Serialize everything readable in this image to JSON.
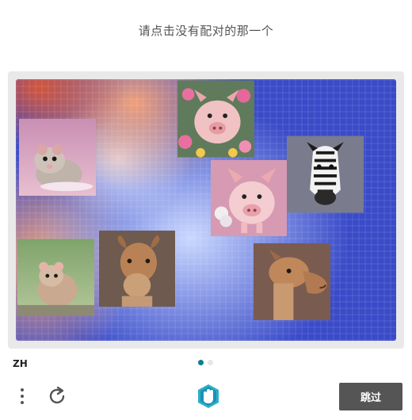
{
  "prompt": "请点击没有配对的那一个",
  "language": "ZH",
  "skip_label": "跳过",
  "pagination": {
    "current": 1,
    "total": 2
  },
  "tiles": [
    {
      "id": "hamster-1",
      "animal": "hamster"
    },
    {
      "id": "pig-1",
      "animal": "pig"
    },
    {
      "id": "zebra",
      "animal": "zebra"
    },
    {
      "id": "pig-2",
      "animal": "pig"
    },
    {
      "id": "hamster-2",
      "animal": "hamster"
    },
    {
      "id": "camel-1",
      "animal": "camel"
    },
    {
      "id": "camel-2",
      "animal": "camel"
    }
  ],
  "icons": {
    "menu": "vertical-dots-icon",
    "refresh": "refresh-icon",
    "brand": "hand-logo-icon"
  },
  "colors": {
    "accent": "#0a7f8f",
    "skip_button": "#555555",
    "canvas_blue": "#3a4bc8"
  }
}
